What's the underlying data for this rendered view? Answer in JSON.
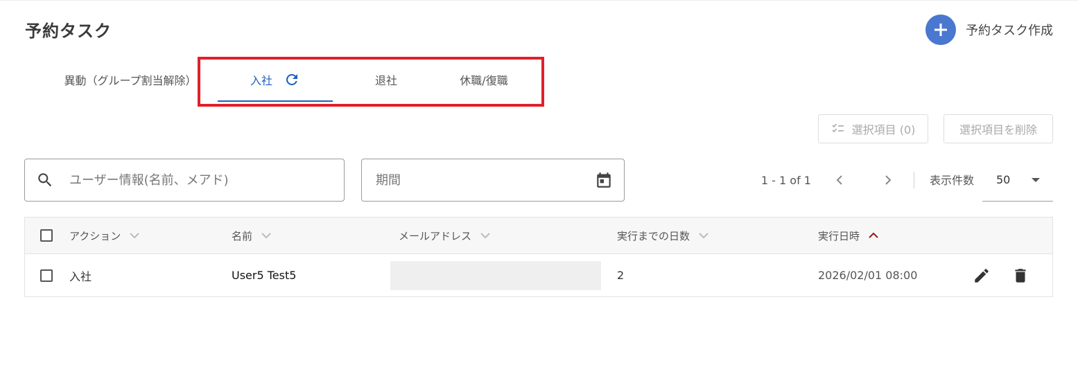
{
  "header": {
    "title": "予約タスク",
    "create_label": "予約タスク作成"
  },
  "tabs": [
    {
      "label": "異動（グループ割当解除）",
      "active": false
    },
    {
      "label": "入社",
      "active": true
    },
    {
      "label": "退社",
      "active": false
    },
    {
      "label": "休職/復職",
      "active": false
    }
  ],
  "selection": {
    "selected_label": "選択項目 (0)",
    "delete_label": "選択項目を削除"
  },
  "filters": {
    "search_placeholder": "ユーザー情報(名前、メアド)",
    "period_placeholder": "期間"
  },
  "pagination": {
    "range_text": "1 - 1 of 1",
    "per_page_label": "表示件数",
    "per_page_value": "50"
  },
  "table": {
    "columns": [
      {
        "label": "アクション",
        "sort": "none"
      },
      {
        "label": "名前",
        "sort": "none"
      },
      {
        "label": "メールアドレス",
        "sort": "none"
      },
      {
        "label": "実行までの日数",
        "sort": "none"
      },
      {
        "label": "実行日時",
        "sort": "asc"
      }
    ],
    "rows": [
      {
        "action": "入社",
        "name": "User5 Test5",
        "email": "",
        "days_until": "2",
        "executed_at": "2026/02/01 08:00"
      }
    ]
  },
  "colors": {
    "accent": "#1f5fbf",
    "create_button": "#4a77cf",
    "highlight": "#e0202a",
    "sort_active": "#8b1a1a"
  },
  "icons": {
    "create": "plus-icon",
    "refresh": "refresh-icon",
    "selection": "checklist-icon",
    "search": "search-icon",
    "calendar": "calendar-icon",
    "prev": "chevron-left-icon",
    "next": "chevron-right-icon",
    "dropdown": "caret-down-icon",
    "edit": "pencil-icon",
    "delete": "trash-icon"
  }
}
